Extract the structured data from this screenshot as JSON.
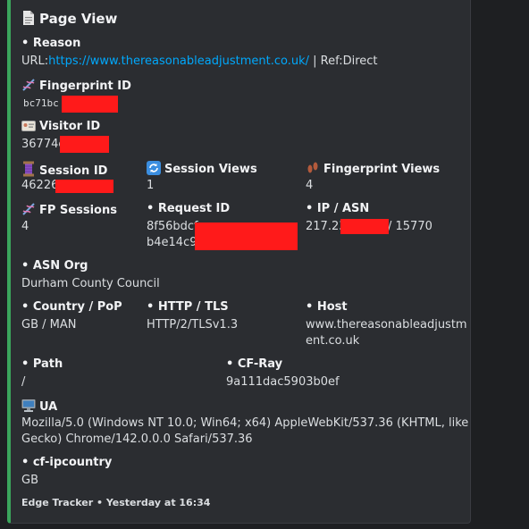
{
  "embed": {
    "title": "Page View",
    "icons": {
      "title": "page-icon",
      "fingerprint_id": "dna-icon",
      "visitor_id": "id-card-icon",
      "session_id": "thread-spool-icon",
      "session_views": "refresh-icon",
      "fingerprint_views": "footprints-icon",
      "fp_sessions": "dna-icon",
      "ua": "computer-icon"
    },
    "reason": {
      "label": "• Reason",
      "prefix": "URL:",
      "url": "https://www.thereasonableadjustment.co.uk/",
      "suffix": " | Ref:Direct"
    },
    "fingerprint_id": {
      "label": "Fingerprint ID",
      "value": "bc71bc"
    },
    "visitor_id": {
      "label": "Visitor ID",
      "value": "36774c"
    },
    "session_id": {
      "label": "Session ID",
      "value": "46226"
    },
    "session_views": {
      "label": "Session Views",
      "value": "1"
    },
    "fingerprint_views": {
      "label": "Fingerprint Views",
      "value": "4"
    },
    "fp_sessions": {
      "label": "FP Sessions",
      "value": "4"
    },
    "request_id": {
      "label": "• Request ID",
      "value_line1": "8f56bdcf",
      "value_line2": "b4e14c9c"
    },
    "ip_asn": {
      "label": "• IP / ASN",
      "value_left": "217.23.",
      "value_right": "/ 15770"
    },
    "asn_org": {
      "label": "• ASN Org",
      "value": "Durham County Council"
    },
    "country_pop": {
      "label": "• Country / PoP",
      "value": "GB / MAN"
    },
    "http_tls": {
      "label": "• HTTP / TLS",
      "value": "HTTP/2/TLSv1.3"
    },
    "host": {
      "label": "• Host",
      "value_line1": "www.thereasonableadjustm",
      "value_line2": "ent.co.uk"
    },
    "path": {
      "label": "• Path",
      "value": "/"
    },
    "cf_ray": {
      "label": "• CF-Ray",
      "value": "9a111dac5903b0ef"
    },
    "ua": {
      "label": "UA",
      "value_line1": "Mozilla/5.0 (Windows NT 10.0; Win64; x64) AppleWebKit/537.36 (KHTML, like",
      "value_line2": "Gecko) Chrome/142.0.0.0 Safari/537.36"
    },
    "cf_ipcountry": {
      "label": "• cf-ipcountry",
      "value": "GB"
    },
    "footer": {
      "source": "Edge Tracker",
      "separator": " • ",
      "time": "Yesterday at 16:34"
    }
  }
}
